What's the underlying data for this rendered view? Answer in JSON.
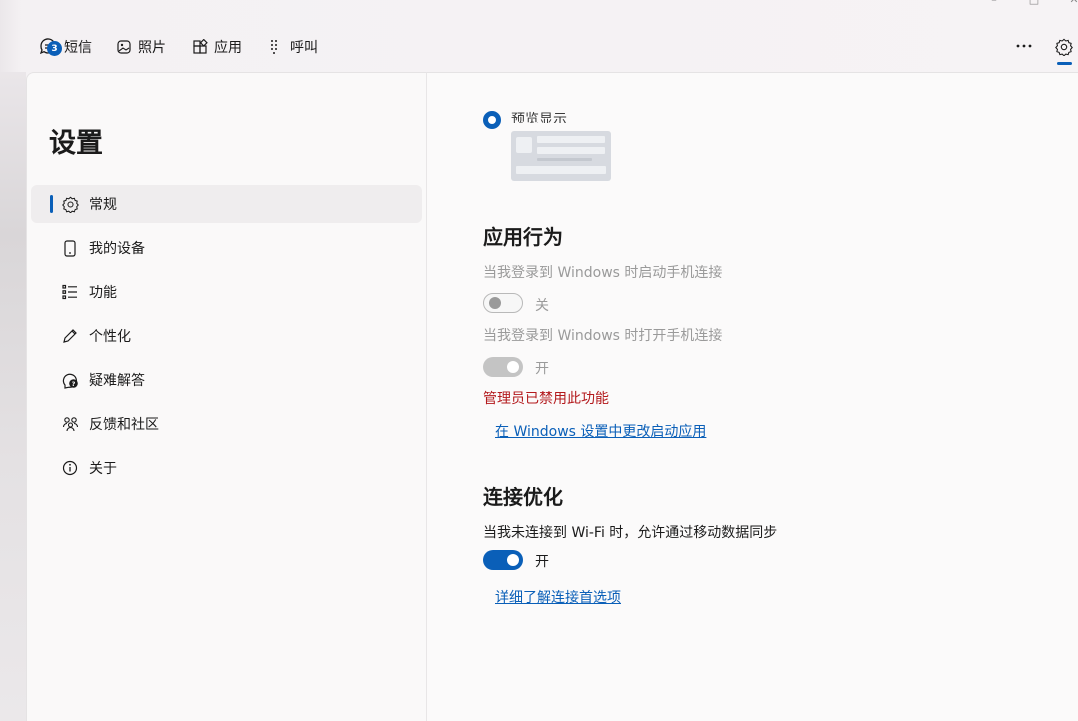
{
  "topnav": {
    "items": [
      {
        "label": "短信",
        "icon": "chat-icon",
        "badge": "3"
      },
      {
        "label": "照片",
        "icon": "photos-icon"
      },
      {
        "label": "应用",
        "icon": "apps-icon"
      },
      {
        "label": "呼叫",
        "icon": "dialpad-icon"
      }
    ],
    "more_icon": "more-icon",
    "settings_icon": "gear-icon"
  },
  "sidebar": {
    "title": "设置",
    "items": [
      {
        "label": "常规",
        "icon": "gear-icon",
        "active": true
      },
      {
        "label": "我的设备",
        "icon": "phone-icon"
      },
      {
        "label": "功能",
        "icon": "list-icon"
      },
      {
        "label": "个性化",
        "icon": "pen-icon"
      },
      {
        "label": "疑难解答",
        "icon": "help-icon"
      },
      {
        "label": "反馈和社区",
        "icon": "people-icon"
      },
      {
        "label": "关于",
        "icon": "info-icon"
      }
    ]
  },
  "content": {
    "preview_radio_label": "预览显示",
    "app_behavior": {
      "heading": "应用行为",
      "startup_desc": "当我登录到 Windows 时启动手机连接",
      "startup_state": "关",
      "open_desc": "当我登录到 Windows 时打开手机连接",
      "open_state": "开",
      "admin_warning": "管理员已禁用此功能",
      "startup_link": "在 Windows 设置中更改启动应用"
    },
    "connection": {
      "heading": "连接优化",
      "mobile_data_desc": "当我未连接到 Wi-Fi 时，允许通过移动数据同步",
      "mobile_data_state": "开",
      "learn_link": "详细了解连接首选项"
    }
  },
  "colors": {
    "accent": "#0a5fb8",
    "warning": "#b3191c",
    "disabled": "#9a9a9a"
  }
}
